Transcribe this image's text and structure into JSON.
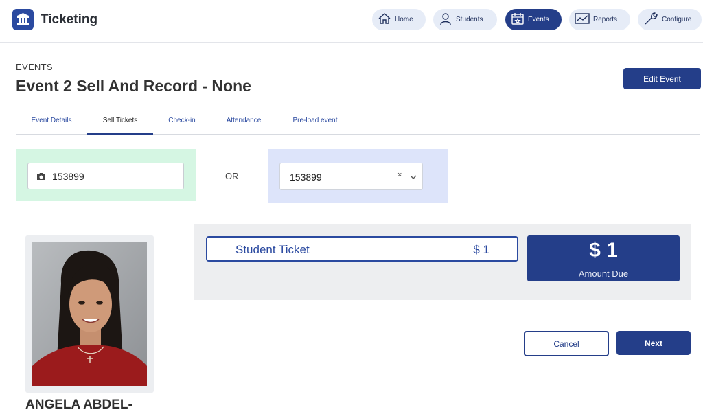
{
  "app": {
    "title": "Ticketing"
  },
  "nav": {
    "home": "Home",
    "students": "Students",
    "events": "Events",
    "reports": "Reports",
    "configure": "Configure"
  },
  "header": {
    "breadcrumb": "EVENTS",
    "title": "Event 2 Sell And Record - None",
    "edit_button": "Edit Event"
  },
  "tabs": [
    {
      "label": "Event Details",
      "active": false
    },
    {
      "label": "Sell Tickets",
      "active": true
    },
    {
      "label": "Check-in",
      "active": false
    },
    {
      "label": "Attendance",
      "active": false
    },
    {
      "label": "Pre-load event",
      "active": false
    }
  ],
  "scan": {
    "value": "153899",
    "icon": "camera-icon"
  },
  "or_label": "OR",
  "student_select": {
    "value": "153899",
    "clear": "×"
  },
  "student": {
    "name": "ANGELA ABDEL-"
  },
  "ticket": {
    "name": "Student Ticket",
    "price": "$ 1"
  },
  "amount_due": {
    "value": "$ 1",
    "label": "Amount Due"
  },
  "actions": {
    "cancel": "Cancel",
    "next": "Next"
  },
  "colors": {
    "primary": "#243e89",
    "nav_bg": "#e6ecf7",
    "scan_bg": "#d5f6e3",
    "select_bg": "#dde4fa",
    "panel_bg": "#edeef0"
  }
}
